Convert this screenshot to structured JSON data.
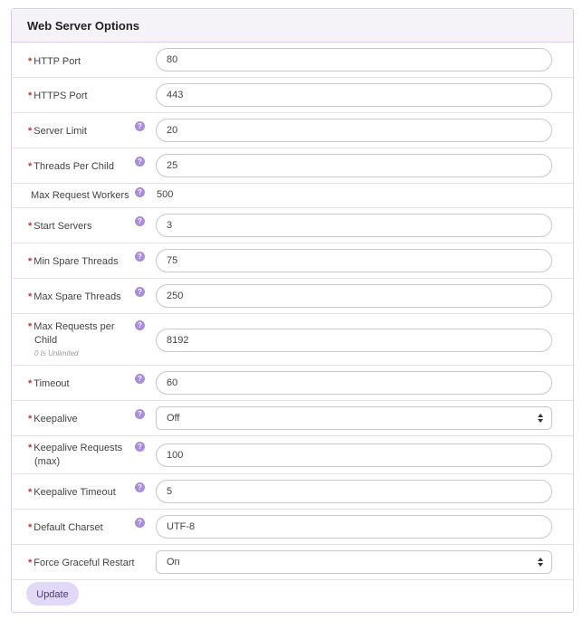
{
  "panel": {
    "title": "Web Server Options"
  },
  "fields": {
    "http_port": {
      "label": "HTTP Port",
      "value": "80"
    },
    "https_port": {
      "label": "HTTPS Port",
      "value": "443"
    },
    "server_limit": {
      "label": "Server Limit",
      "value": "20"
    },
    "threads_per_child": {
      "label": "Threads Per Child",
      "value": "25"
    },
    "max_request_workers": {
      "label": "Max Request Workers",
      "value": "500"
    },
    "start_servers": {
      "label": "Start Servers",
      "value": "3"
    },
    "min_spare_threads": {
      "label": "Min Spare Threads",
      "value": "75"
    },
    "max_spare_threads": {
      "label": "Max Spare Threads",
      "value": "250"
    },
    "max_requests_per_child": {
      "label_line1": "Max Requests per",
      "label_line2": "Child",
      "note": "0 Is Unlimited",
      "value": "8192"
    },
    "timeout": {
      "label": "Timeout",
      "value": "60"
    },
    "keepalive": {
      "label": "Keepalive",
      "value": "Off"
    },
    "keepalive_requests": {
      "label_line1": "Keepalive Requests",
      "label_line2": "(max)",
      "value": "100"
    },
    "keepalive_timeout": {
      "label": "Keepalive Timeout",
      "value": "5"
    },
    "default_charset": {
      "label": "Default Charset",
      "value": "UTF-8"
    },
    "force_graceful_restart": {
      "label": "Force Graceful Restart",
      "value": "On"
    }
  },
  "required_marker": "*",
  "help_icon_glyph": "?",
  "actions": {
    "update_label": "Update"
  },
  "colors": {
    "accent": "#a98be6",
    "button_bg": "#e2d8f7",
    "required": "#c0392b"
  }
}
